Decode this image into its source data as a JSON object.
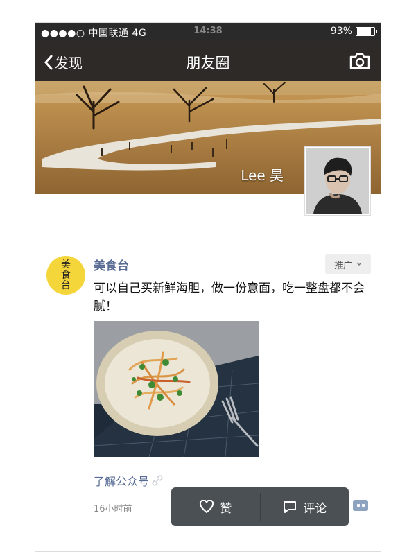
{
  "status_bar": {
    "carrier": "●●●●○ 中国联通  4G",
    "time": "14:38",
    "battery_label": "93%",
    "battery_level": 0.93
  },
  "nav": {
    "back_label": "发现",
    "title": "朋友圈",
    "camera_icon": "camera-icon"
  },
  "profile": {
    "name": "Lee 昊"
  },
  "post": {
    "author": "美食台",
    "avatar_text": "美食台",
    "promo_label": "推广",
    "text": "可以自己买新鲜海胆，做一份意面，吃一整盘都不会腻！",
    "link_label": "了解公众号",
    "time": "16小时前"
  },
  "actions": {
    "like_label": "赞",
    "comment_label": "评论"
  },
  "colors": {
    "link": "#576b95",
    "nav_bg": "#2d2a27",
    "popup_bg": "#4b5055",
    "avatar_bg": "#f4d63b"
  }
}
